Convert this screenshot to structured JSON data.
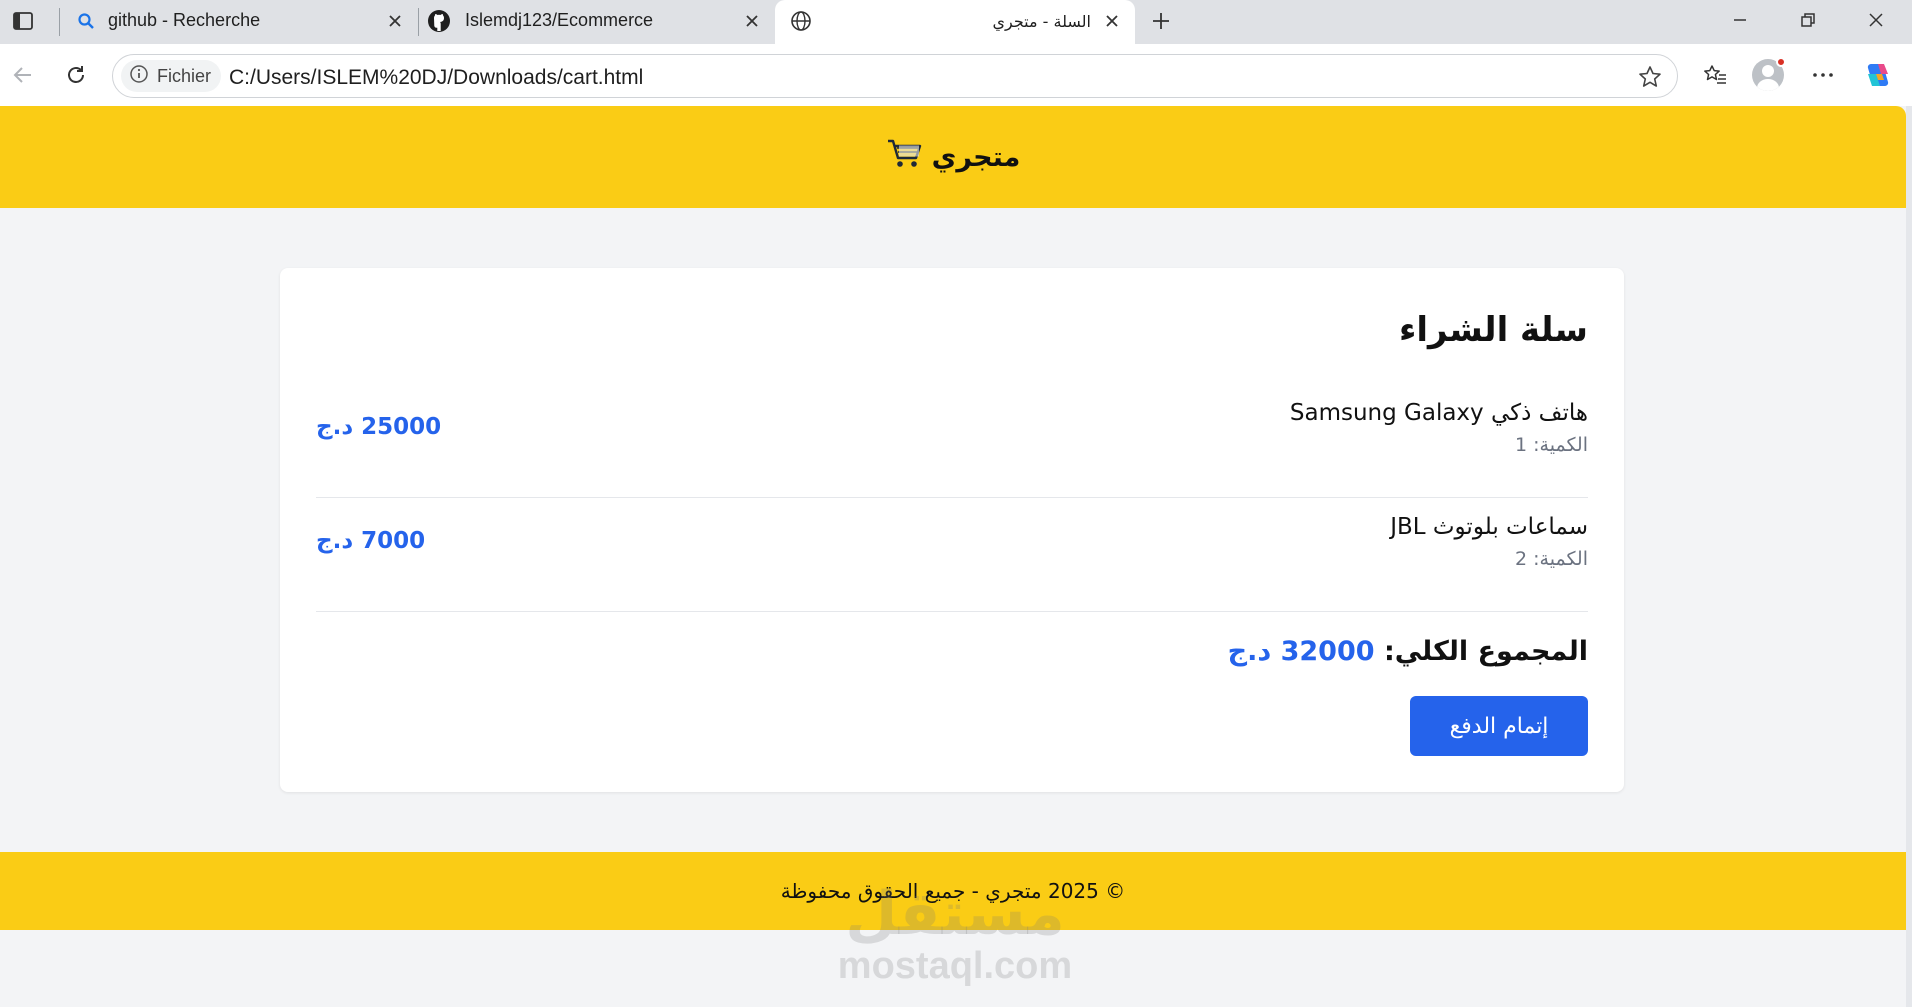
{
  "browser": {
    "tabs": [
      {
        "title": "github - Recherche",
        "icon": "search-icon",
        "active": false
      },
      {
        "title": "Islemdj123/Ecommerce",
        "icon": "github-icon",
        "active": false
      },
      {
        "title": "السلة - متجري",
        "icon": "globe-icon",
        "active": true
      }
    ],
    "address": {
      "chip_label": "Fichier",
      "url": "C:/Users/ISLEM%20DJ/Downloads/cart.html"
    }
  },
  "page": {
    "header": {
      "logo_icon": "🛒",
      "logo_text": "متجري"
    },
    "cart": {
      "title": "سلة الشراء",
      "items": [
        {
          "name": "هاتف ذكي Samsung Galaxy",
          "quantity": "الكمية: 1",
          "price": "25000 د.ج"
        },
        {
          "name": "سماعات بلوتوث JBL",
          "quantity": "الكمية: 2",
          "price": "7000 د.ج"
        }
      ],
      "total_label": "المجموع الكلي:",
      "total_value": "32000 د.ج",
      "checkout_label": "إتمام الدفع"
    },
    "footer": {
      "text": "© 2025 متجري - جميع الحقوق محفوظة"
    },
    "watermark": {
      "text": "mostaql.com"
    }
  },
  "colors": {
    "header_bg": "#facc15",
    "accent": "#2563eb",
    "page_bg": "#f3f4f6"
  }
}
